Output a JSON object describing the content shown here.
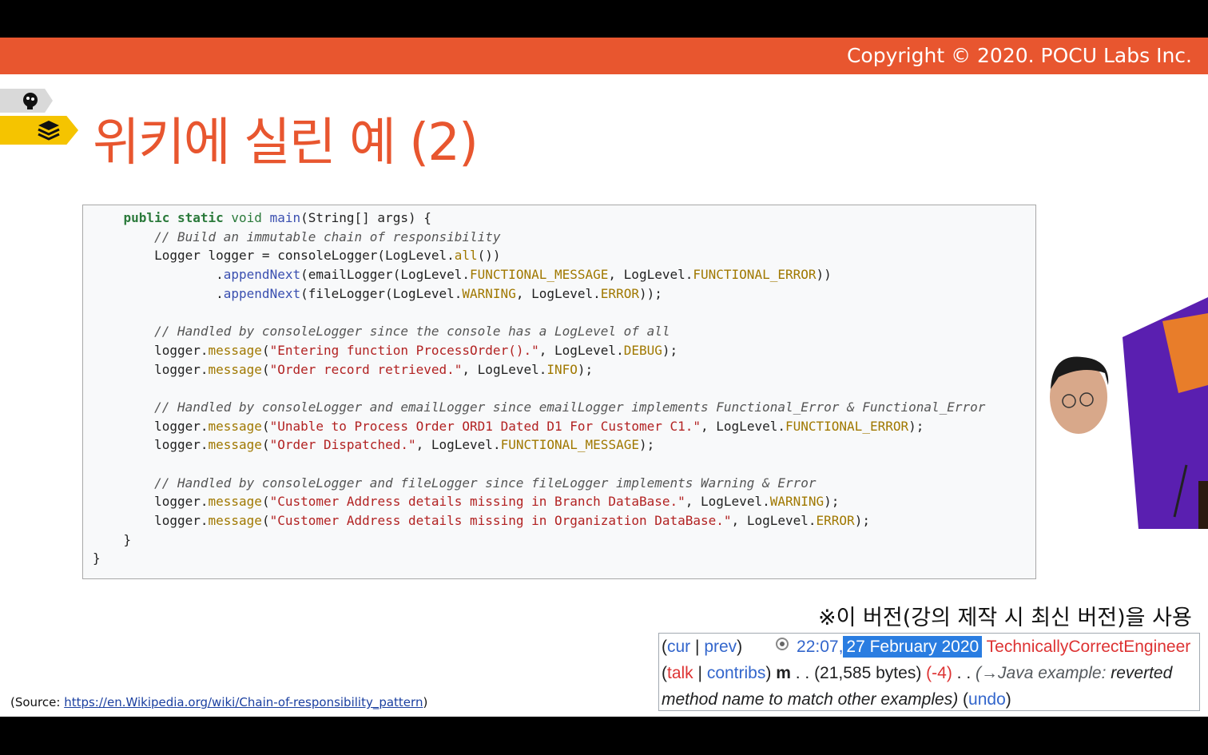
{
  "header": {
    "copyright": "Copyright © 2020. POCU Labs Inc."
  },
  "slide": {
    "title": "위키에 실린 예 (2)"
  },
  "code_lines": [
    [
      [
        "p",
        "    "
      ],
      [
        "k",
        "public static "
      ],
      [
        "t",
        "void "
      ],
      [
        "fn",
        "main"
      ],
      [
        "p",
        "(String[] args) {"
      ]
    ],
    [
      [
        "p",
        "        "
      ],
      [
        "cm",
        "// Build an immutable chain of responsibility"
      ]
    ],
    [
      [
        "p",
        "        Logger logger = consoleLogger(LogLevel."
      ],
      [
        "fld",
        "all"
      ],
      [
        "p",
        "())"
      ]
    ],
    [
      [
        "p",
        "                ."
      ],
      [
        "fn",
        "appendNext"
      ],
      [
        "p",
        "(emailLogger(LogLevel."
      ],
      [
        "fld",
        "FUNCTIONAL_MESSAGE"
      ],
      [
        "p",
        ", LogLevel."
      ],
      [
        "fld",
        "FUNCTIONAL_ERROR"
      ],
      [
        "p",
        "))"
      ]
    ],
    [
      [
        "p",
        "                ."
      ],
      [
        "fn",
        "appendNext"
      ],
      [
        "p",
        "(fileLogger(LogLevel."
      ],
      [
        "fld",
        "WARNING"
      ],
      [
        "p",
        ", LogLevel."
      ],
      [
        "fld",
        "ERROR"
      ],
      [
        "p",
        "));"
      ]
    ],
    [
      [
        "p",
        ""
      ]
    ],
    [
      [
        "p",
        "        "
      ],
      [
        "cm",
        "// Handled by consoleLogger since the console has a LogLevel of all"
      ]
    ],
    [
      [
        "p",
        "        logger."
      ],
      [
        "fld",
        "message"
      ],
      [
        "p",
        "("
      ],
      [
        "str",
        "\"Entering function ProcessOrder().\""
      ],
      [
        "p",
        ", LogLevel."
      ],
      [
        "fld",
        "DEBUG"
      ],
      [
        "p",
        ");"
      ]
    ],
    [
      [
        "p",
        "        logger."
      ],
      [
        "fld",
        "message"
      ],
      [
        "p",
        "("
      ],
      [
        "str",
        "\"Order record retrieved.\""
      ],
      [
        "p",
        ", LogLevel."
      ],
      [
        "fld",
        "INFO"
      ],
      [
        "p",
        ");"
      ]
    ],
    [
      [
        "p",
        ""
      ]
    ],
    [
      [
        "p",
        "        "
      ],
      [
        "cm",
        "// Handled by consoleLogger and emailLogger since emailLogger implements Functional_Error & Functional_Error"
      ]
    ],
    [
      [
        "p",
        "        logger."
      ],
      [
        "fld",
        "message"
      ],
      [
        "p",
        "("
      ],
      [
        "str",
        "\"Unable to Process Order ORD1 Dated D1 For Customer C1.\""
      ],
      [
        "p",
        ", LogLevel."
      ],
      [
        "fld",
        "FUNCTIONAL_ERROR"
      ],
      [
        "p",
        ");"
      ]
    ],
    [
      [
        "p",
        "        logger."
      ],
      [
        "fld",
        "message"
      ],
      [
        "p",
        "("
      ],
      [
        "str",
        "\"Order Dispatched.\""
      ],
      [
        "p",
        ", LogLevel."
      ],
      [
        "fld",
        "FUNCTIONAL_MESSAGE"
      ],
      [
        "p",
        ");"
      ]
    ],
    [
      [
        "p",
        ""
      ]
    ],
    [
      [
        "p",
        "        "
      ],
      [
        "cm",
        "// Handled by consoleLogger and fileLogger since fileLogger implements Warning & Error"
      ]
    ],
    [
      [
        "p",
        "        logger."
      ],
      [
        "fld",
        "message"
      ],
      [
        "p",
        "("
      ],
      [
        "str",
        "\"Customer Address details missing in Branch DataBase.\""
      ],
      [
        "p",
        ", LogLevel."
      ],
      [
        "fld",
        "WARNING"
      ],
      [
        "p",
        ");"
      ]
    ],
    [
      [
        "p",
        "        logger."
      ],
      [
        "fld",
        "message"
      ],
      [
        "p",
        "("
      ],
      [
        "str",
        "\"Customer Address details missing in Organization DataBase.\""
      ],
      [
        "p",
        ", LogLevel."
      ],
      [
        "fld",
        "ERROR"
      ],
      [
        "p",
        ");"
      ]
    ],
    [
      [
        "p",
        "    }"
      ]
    ],
    [
      [
        "p",
        "}"
      ]
    ]
  ],
  "note": "※이 버전(강의 제작 시 최신 버전)을 사용",
  "revision": {
    "open_paren": "(",
    "cur": "cur",
    "sep": " | ",
    "prev": "prev",
    "close_paren": ")",
    "time": "22:07,",
    "date": "27 February 2020",
    "user": "TechnicallyCorrectEngineer",
    "talk": "talk",
    "contribs": "contribs",
    "minor": "m",
    "dots1": " . . ",
    "bytes": "(21,585 bytes)",
    "diff": "(-4)",
    "dots2": " . . ",
    "summary_arrow": "(→Java example: ",
    "summary_rest": "reverted",
    "summary_line2": "method name to match other examples)",
    "undo": "undo"
  },
  "source": {
    "prefix": "(Source: ",
    "url": "https://en.Wikipedia.org/wiki/Chain-of-responsibility_pattern",
    "suffix": ")"
  }
}
